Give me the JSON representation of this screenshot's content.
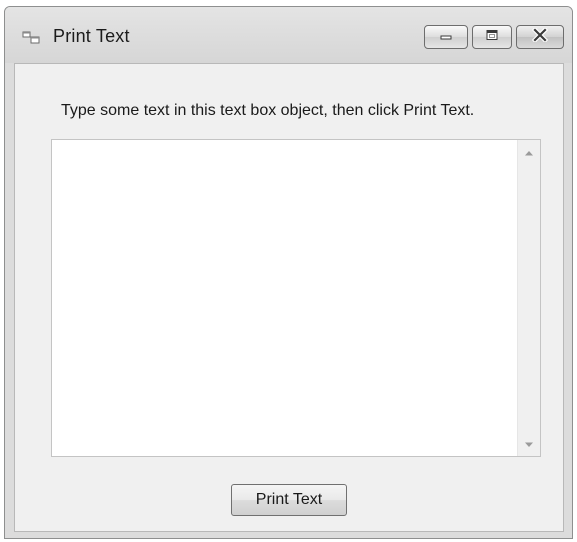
{
  "window": {
    "title": "Print Text",
    "icon": "app-window-icon",
    "caption_buttons": [
      "minimize-icon",
      "maximize-icon",
      "close-icon"
    ]
  },
  "form": {
    "prompt": "Type some text in this text box object, then click Print Text.",
    "textbox_value": "",
    "print_button_label": "Print Text"
  }
}
